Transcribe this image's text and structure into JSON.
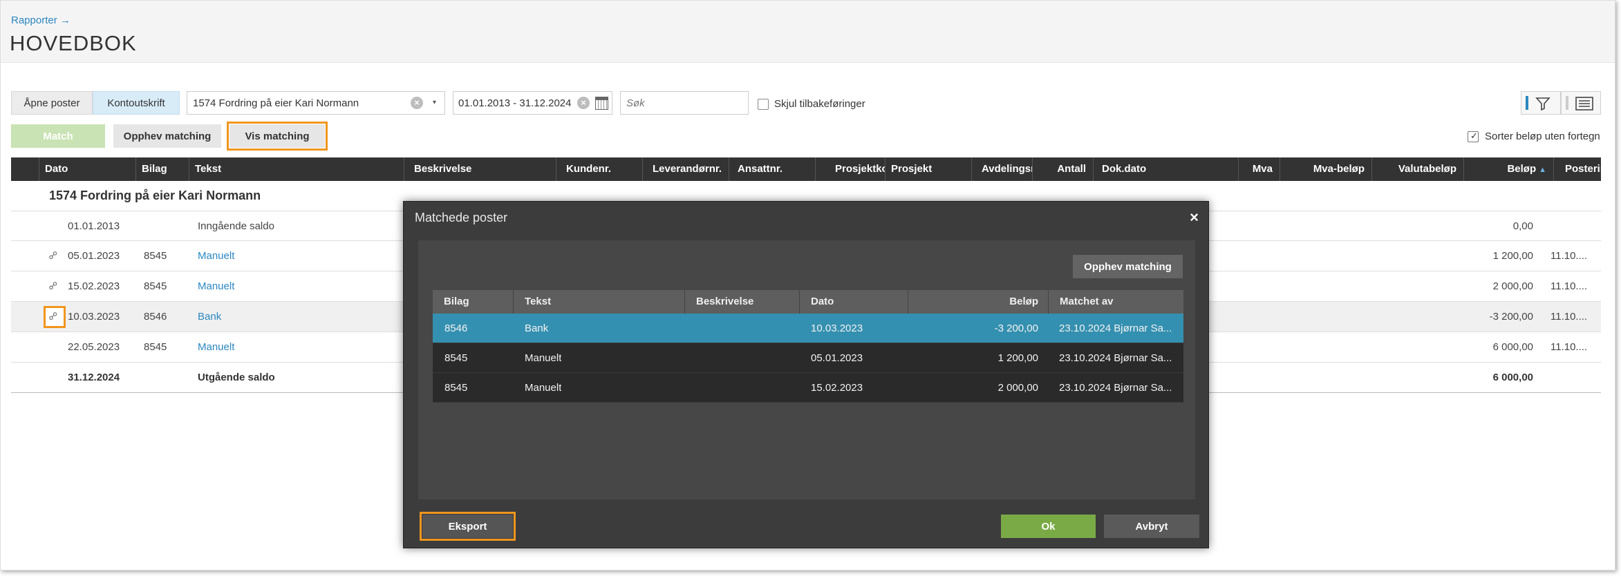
{
  "breadcrumb": "Rapporter →",
  "page_title": "HOVEDBOK",
  "toolbar": {
    "open_posts": "Åpne poster",
    "account_statement": "Kontoutskrift",
    "account_value": "1574 Fordring på eier Kari Normann",
    "date_range": "01.01.2013 - 31.12.2024",
    "search_placeholder": "Søk",
    "hide_reversals": "Skjul tilbakeføringer",
    "match": "Match",
    "unmatch": "Opphev matching",
    "show_matching": "Vis matching",
    "sort_unsigned": "Sorter beløp uten fortegn"
  },
  "table": {
    "headers": {
      "dato": "Dato",
      "bilag": "Bilag",
      "tekst": "Tekst",
      "beskrivelse": "Beskrivelse",
      "kundenr": "Kundenr.",
      "leverandornr": "Leverandørnr.",
      "ansattnr": "Ansattnr.",
      "prosjektkode": "Prosjektkode",
      "prosjekt": "Prosjekt",
      "avdeling": "Avdelingsnr.",
      "antall": "Antall",
      "dokdato": "Dok.dato",
      "mva": "Mva",
      "mva_belop": "Mva-beløp",
      "valuta": "Valutabeløp",
      "belop": "Beløp",
      "postering": "Posteringsdato"
    },
    "group_title": "1574 Fordring på eier Kari Normann",
    "rows": [
      {
        "dato": "01.01.2013",
        "bilag": "",
        "tekst": "Inngående saldo",
        "belop": "0,00",
        "postering": ""
      },
      {
        "dato": "05.01.2023",
        "bilag": "8545",
        "tekst": "Manuelt",
        "belop": "1 200,00",
        "postering": "11.10...."
      },
      {
        "dato": "15.02.2023",
        "bilag": "8545",
        "tekst": "Manuelt",
        "belop": "2 000,00",
        "postering": "11.10...."
      },
      {
        "dato": "10.03.2023",
        "bilag": "8546",
        "tekst": "Bank",
        "belop": "-3 200,00",
        "postering": "11.10...."
      },
      {
        "dato": "22.05.2023",
        "bilag": "8545",
        "tekst": "Manuelt",
        "belop": "6 000,00",
        "postering": "11.10...."
      },
      {
        "dato": "31.12.2024",
        "bilag": "",
        "tekst": "Utgående saldo",
        "belop": "6 000,00",
        "postering": ""
      }
    ]
  },
  "modal": {
    "title": "Matchede poster",
    "close": "×",
    "unmatch": "Opphev matching",
    "headers": {
      "bilag": "Bilag",
      "tekst": "Tekst",
      "beskrivelse": "Beskrivelse",
      "dato": "Dato",
      "belop": "Beløp",
      "matchet_av": "Matchet av"
    },
    "rows": [
      {
        "bilag": "8546",
        "tekst": "Bank",
        "beskrivelse": "",
        "dato": "10.03.2023",
        "belop": "-3 200,00",
        "matchet_av": "23.10.2024 Bjørnar Sa..."
      },
      {
        "bilag": "8545",
        "tekst": "Manuelt",
        "beskrivelse": "",
        "dato": "05.01.2023",
        "belop": "1 200,00",
        "matchet_av": "23.10.2024 Bjørnar Sa..."
      },
      {
        "bilag": "8545",
        "tekst": "Manuelt",
        "beskrivelse": "",
        "dato": "15.02.2023",
        "belop": "2 000,00",
        "matchet_av": "23.10.2024 Bjørnar Sa..."
      }
    ],
    "export": "Eksport",
    "ok": "Ok",
    "cancel": "Avbryt"
  },
  "colors": {
    "accent": "#2b87c0",
    "highlight": "#f0961e",
    "selected_row": "#3490b0",
    "ok": "#7aaa46"
  }
}
